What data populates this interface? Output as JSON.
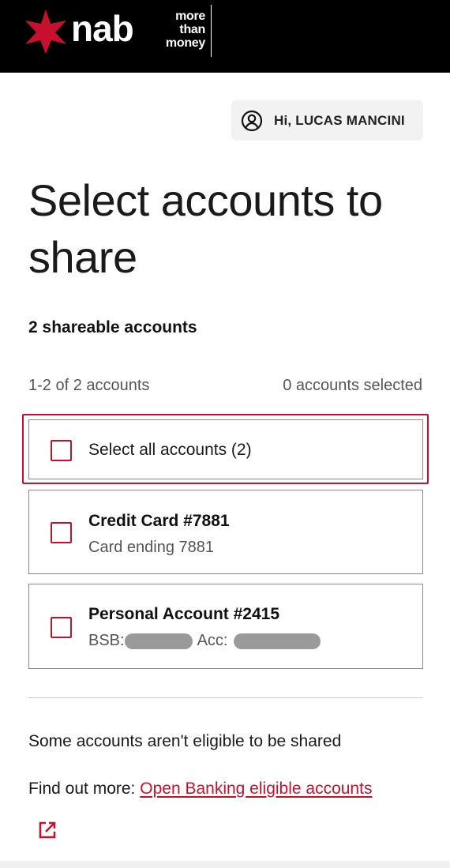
{
  "brand": {
    "wordmark": "nab",
    "tagline": [
      "more",
      "than",
      "money"
    ],
    "accent_color": "#c8102e"
  },
  "user": {
    "greeting": "Hi, LUCAS MANCINI",
    "icon": "user-circle-icon"
  },
  "page": {
    "title": "Select accounts to share",
    "shareable_count": "2 shareable accounts",
    "range": "1-2 of 2 accounts",
    "selected": "0 accounts selected"
  },
  "select_all": {
    "label": "Select all accounts (2)",
    "checked": false
  },
  "accounts": [
    {
      "title": "Credit Card #7881",
      "subtitle": "Card ending 7881",
      "checked": false
    },
    {
      "title": "Personal Account #2415",
      "bsb_label": "BSB:",
      "acc_label": "Acc:",
      "checked": false
    }
  ],
  "footer": {
    "ineligible_note": "Some accounts aren't eligible to be shared",
    "find_more_prefix": "Find out more:",
    "link_label": "Open Banking eligible accounts",
    "link_icon": "external-link-icon"
  }
}
